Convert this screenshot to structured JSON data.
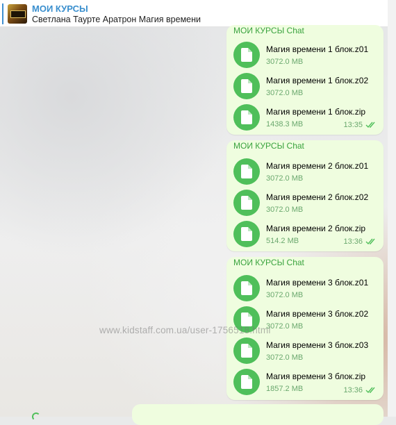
{
  "header": {
    "channel_name": "МОИ КУРСЫ",
    "pinned_text": "Светлана Таурте Аратрон Магия времени"
  },
  "messages": [
    {
      "sender": "МОИ КУРСЫ Chat",
      "time": "13:35",
      "files": [
        {
          "name": "Магия времени 1 блок.z01",
          "size": "3072.0 MB"
        },
        {
          "name": "Магия времени 1 блок.z02",
          "size": "3072.0 MB"
        },
        {
          "name": "Магия времени 1 блок.zip",
          "size": "1438.3 MB"
        }
      ]
    },
    {
      "sender": "МОИ КУРСЫ Chat",
      "time": "13:36",
      "files": [
        {
          "name": "Магия времени 2 блок.z01",
          "size": "3072.0 MB"
        },
        {
          "name": "Магия времени 2 блок.z02",
          "size": "3072.0 MB"
        },
        {
          "name": "Магия времени 2 блок.zip",
          "size": "514.2 MB"
        }
      ]
    },
    {
      "sender": "МОИ КУРСЫ Chat",
      "time": "13:36",
      "files": [
        {
          "name": "Магия времени 3 блок.z01",
          "size": "3072.0 MB"
        },
        {
          "name": "Магия времени 3 блок.z02",
          "size": "3072.0 MB"
        },
        {
          "name": "Магия времени 3 блок.z03",
          "size": "3072.0 MB"
        },
        {
          "name": "Магия времени 3 блок.zip",
          "size": "1857.2 MB"
        }
      ]
    }
  ],
  "watermark": "www.kidstaff.com.ua/user-1756518.html",
  "icons": {
    "file": "document-icon",
    "status": "double-check-icon"
  },
  "colors": {
    "accent": "#3a8fce",
    "bubble": "#effddf",
    "file_icon": "#4fbf5a",
    "sender": "#3aa33e"
  }
}
